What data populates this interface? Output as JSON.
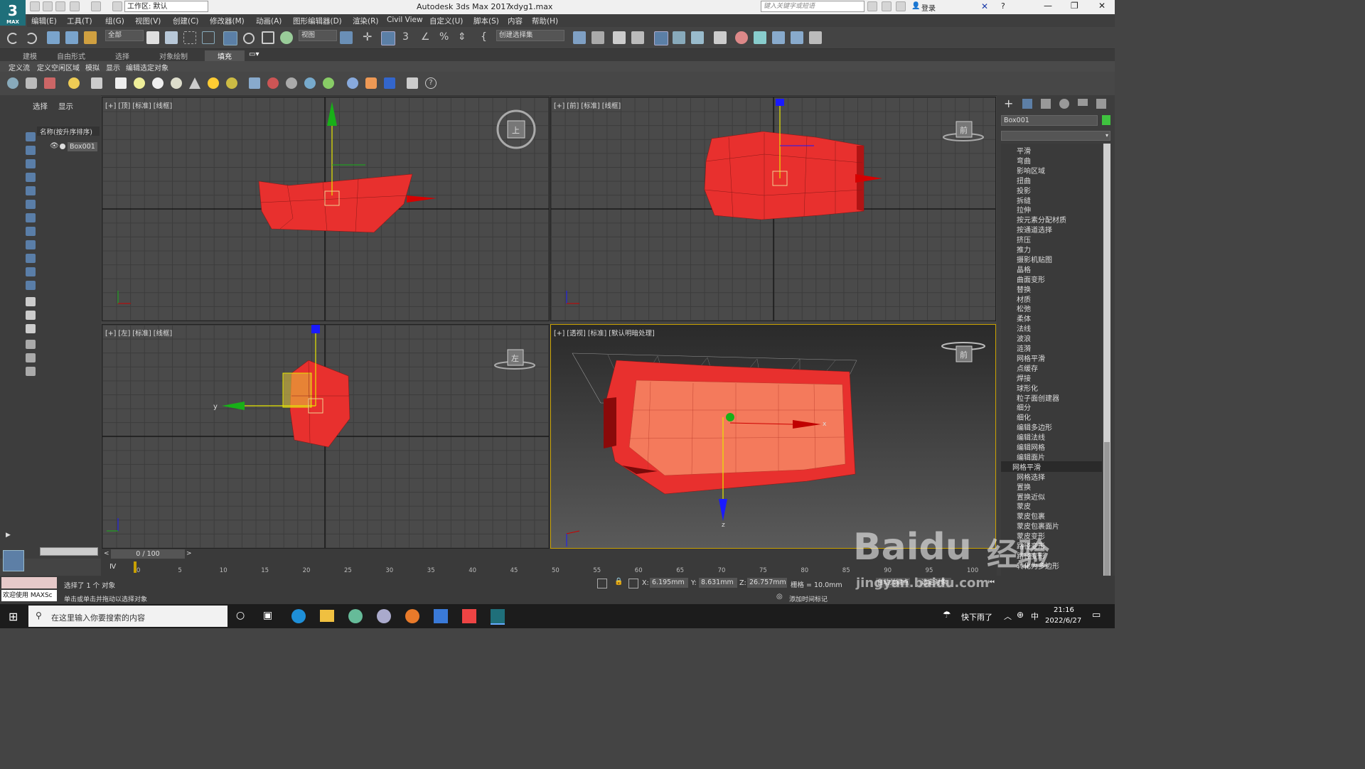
{
  "window": {
    "title": "Autodesk 3ds Max 2017",
    "file": "xdyg1.max",
    "workspace": "工作区: 默认",
    "search_placeholder": "键入关键字或短语",
    "login": "登录"
  },
  "logo": {
    "digit": "3",
    "sub": "MAX"
  },
  "menu": [
    "编辑(E)",
    "工具(T)",
    "组(G)",
    "视图(V)",
    "创建(C)",
    "修改器(M)",
    "动画(A)",
    "图形编辑器(D)",
    "渲染(R)",
    "Civil View",
    "自定义(U)",
    "脚本(S)",
    "内容",
    "帮助(H)"
  ],
  "toolbar": {
    "filter": "全部",
    "refcoord": "视图",
    "selection_set": "创建选择集"
  },
  "ribbon_tabs": [
    "建模",
    "自由形式",
    "选择",
    "对象绘制",
    "填充"
  ],
  "ribbon_subtabs": [
    "定义流",
    "定义空闲区域",
    "模拟",
    "显示",
    "编辑选定对象"
  ],
  "scene_explorer": {
    "tabs": [
      "选择",
      "显示"
    ],
    "header": "名称(按升序排序)",
    "object": "Box001"
  },
  "viewports": {
    "top": "[+] [顶] [标准] [线框]",
    "front": "[+] [前] [标准] [线框]",
    "left": "[+] [左] [标准] [线框]",
    "persp": "[+] [透视] [标准] [默认明暗处理]"
  },
  "viewcube": {
    "top": "上",
    "front": "前",
    "left": "左",
    "persp": "前"
  },
  "gizmo": {
    "y": "y",
    "z": "z",
    "x": "x"
  },
  "command_panel": {
    "object_name": "Box001",
    "modifiers": [
      "平滑",
      "弯曲",
      "影响区域",
      "扭曲",
      "投影",
      "拆缝",
      "拉伸",
      "按元素分配材质",
      "按通道选择",
      "挤压",
      "推力",
      "摄影机贴图",
      "晶格",
      "曲面变形",
      "替换",
      "材质",
      "松弛",
      "柔体",
      "法线",
      "波浪",
      "涟漪",
      "网格平滑",
      "点缓存",
      "焊接",
      "球形化",
      "粒子面创建器",
      "细分",
      "细化",
      "编辑多边形",
      "编辑法线",
      "编辑网格",
      "编辑面片",
      "网格平滑",
      "网格选择",
      "置换",
      "置换近似",
      "蒙皮",
      "蒙皮包裹",
      "蒙皮包裹面片",
      "蒙皮变形",
      "路径变形",
      "路径变形",
      "转化为多边形"
    ],
    "selected_index": 32
  },
  "timeline": {
    "frame": "0 / 100",
    "ticks": [
      "0",
      "5",
      "10",
      "15",
      "20",
      "25",
      "30",
      "35",
      "40",
      "45",
      "50",
      "55",
      "60",
      "65",
      "70",
      "75",
      "80",
      "85",
      "90",
      "95",
      "100"
    ]
  },
  "status": {
    "maxscript": "欢迎使用 MAXSc",
    "line1": "选择了 1 个 对象",
    "line2": "单击或单击并拖动以选择对象",
    "x_label": "X:",
    "x": "6.195mm",
    "y_label": "Y:",
    "y": "8.631mm",
    "z_label": "Z:",
    "z": "26.757mm",
    "grid": "栅格 = 10.0mm",
    "add_time_tag": "添加时间标记",
    "autokey": "自动关键点",
    "setkey": "选定对象"
  },
  "taskbar": {
    "search_placeholder": "在这里输入你要搜索的内容",
    "weather": "快下雨了",
    "ime": "中",
    "time": "21:16",
    "date": "2022/6/27"
  },
  "watermark": {
    "brand": "Baidu",
    "cn": "经验",
    "url": "jingyan.baidu.com"
  },
  "colors": {
    "object": "#e8302e",
    "object_light": "#f47a5c",
    "gizmo_x": "#cc0000",
    "gizmo_y": "#18b018",
    "gizmo_z": "#1a1aff",
    "active_border": "#c8a000"
  }
}
